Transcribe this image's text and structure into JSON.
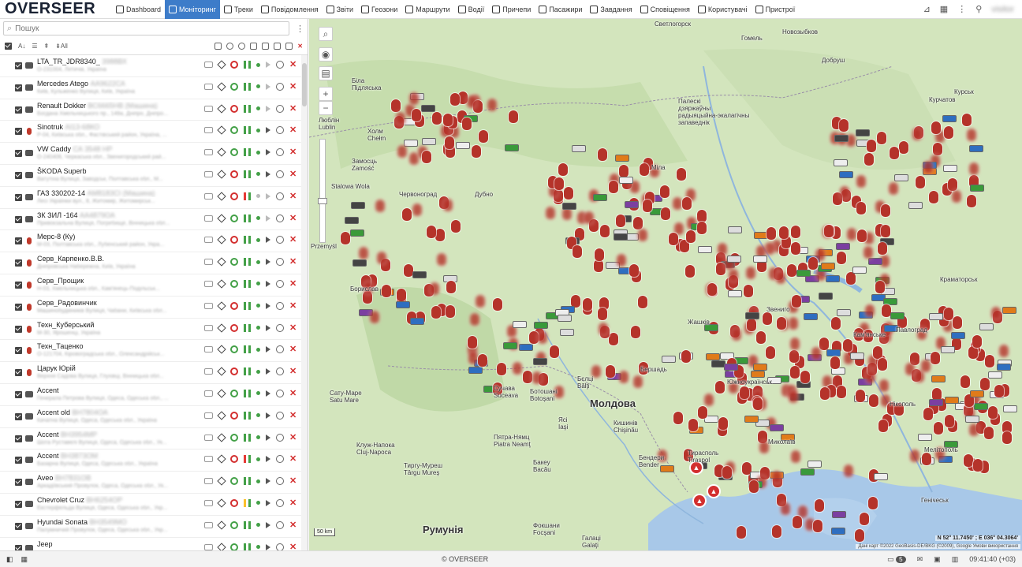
{
  "app": {
    "logo": "OVERSEER"
  },
  "nav": [
    {
      "label": "Dashboard",
      "icon": "chart-icon",
      "active": false
    },
    {
      "label": "Моніторинг",
      "icon": "globe-icon",
      "active": true
    },
    {
      "label": "Треки",
      "icon": "flag-icon",
      "active": false
    },
    {
      "label": "Повідомлення",
      "icon": "list-icon",
      "active": false
    },
    {
      "label": "Звіти",
      "icon": "report-icon",
      "active": false
    },
    {
      "label": "Геозони",
      "icon": "geofence-icon",
      "active": false
    },
    {
      "label": "Маршрути",
      "icon": "route-icon",
      "active": false
    },
    {
      "label": "Водії",
      "icon": "driver-icon",
      "active": false
    },
    {
      "label": "Причепи",
      "icon": "trailer-icon",
      "active": false
    },
    {
      "label": "Пасажири",
      "icon": "passenger-icon",
      "active": false
    },
    {
      "label": "Завдання",
      "icon": "task-icon",
      "active": false
    },
    {
      "label": "Сповіщення",
      "icon": "alarm-icon",
      "active": false
    },
    {
      "label": "Користувачі",
      "icon": "user-icon",
      "active": false
    },
    {
      "label": "Пристрої",
      "icon": "device-icon",
      "active": false
    }
  ],
  "user": {
    "name": "visitor"
  },
  "search": {
    "placeholder": "Пошук"
  },
  "toolbar": {
    "all_label": "All"
  },
  "units": [
    {
      "name": "LTA_TR_JDR8340_",
      "plate": "3988ВХ",
      "addr": "О-231004, Летичів, Україна",
      "icon": "truck",
      "status": "red",
      "pause": "green",
      "dot": "green",
      "play": "grey"
    },
    {
      "name": "Mercedes Atego",
      "plate": "АА9622СА",
      "addr": "Київ, Кульженко Вулиця, Київ, Україна",
      "icon": "van",
      "status": "green",
      "pause": "green",
      "dot": "green",
      "play": "grey"
    },
    {
      "name": "Renault Dokker",
      "plate": "ВС6665НВ (Машина)",
      "addr": "Богдана Хмельницького пр., 148а, Дніпро, Дніпро...",
      "icon": "car",
      "status": "red",
      "pause": "green",
      "dot": "green",
      "play": "grey"
    },
    {
      "name": "Sinotruk",
      "plate": "АІ13-68КО",
      "addr": "Р-04, Київська обл., Фастівський район, Україна, ...",
      "icon": "red",
      "status": "green",
      "pause": "green",
      "dot": "green",
      "play": "gps"
    },
    {
      "name": "VW Caddy",
      "plate": "СА 3548 НР",
      "addr": "О-240406, Черкаська обл., Звенигородський рай...",
      "icon": "car",
      "status": "green",
      "pause": "green",
      "dot": "green",
      "play": "gps"
    },
    {
      "name": "ŠKODA Superb",
      "plate": "",
      "addr": "Ватутіна Вулиця, Заводськ, Полтавська обл., М...",
      "icon": "car",
      "status": "red",
      "pause": "green",
      "dot": "green",
      "play": "gps"
    },
    {
      "name": "ГАЗ 330202-14",
      "plate": "АМ8183СІ (Машина)",
      "addr": "Лесі Українки вул., 8, Житомир, Житомирськ...",
      "icon": "truck",
      "status": "red",
      "pause": "red",
      "dot": "grey",
      "play": "grey"
    },
    {
      "name": "ЗК ЗИЛ -164",
      "plate": "АА4879ОА",
      "addr": "Привокзальна Вулиця, Погребище, Вінницька обл...",
      "icon": "truck",
      "status": "green",
      "pause": "green",
      "dot": "green",
      "play": "grey"
    },
    {
      "name": "Мерс-8 (Ку)",
      "plate": "",
      "addr": "М-03, Полтавська обл., Лубенський район, Укра...",
      "icon": "red",
      "status": "red",
      "pause": "green",
      "dot": "green",
      "play": "gps"
    },
    {
      "name": "Серв_Карпенко.В.В.",
      "plate": "",
      "addr": "Дніпровська Набережна, Київ, Україна",
      "icon": "red",
      "status": "green",
      "pause": "green",
      "dot": "green",
      "play": "gps"
    },
    {
      "name": "Серв_Прощик",
      "plate": "",
      "addr": "Н-03, Хмельницька обл., Кам'янець-Подільськ...",
      "icon": "red",
      "status": "green",
      "pause": "green",
      "dot": "green",
      "play": "gps"
    },
    {
      "name": "Серв_Радовинчик",
      "plate": "",
      "addr": "Машинобудівників Вулиця, Чабани, Київська обл...",
      "icon": "red",
      "status": "red",
      "pause": "green",
      "dot": "green",
      "play": "gps"
    },
    {
      "name": "Техн_Куберський",
      "plate": "",
      "addr": "М-30, Ярошенці, Україна",
      "icon": "red",
      "status": "red",
      "pause": "green",
      "dot": "green",
      "play": "gps"
    },
    {
      "name": "Техн_Таценко",
      "plate": "",
      "addr": "О-121704, Кіровоградська обл., Олександрійськ...",
      "icon": "red",
      "status": "green",
      "pause": "green",
      "dot": "green",
      "play": "gps"
    },
    {
      "name": "Царук Юрій",
      "plate": "",
      "addr": "Верхня Садова Вулиця, Глухівці, Вінницька обл...",
      "icon": "red",
      "status": "red",
      "pause": "green",
      "dot": "green",
      "play": "gps"
    },
    {
      "name": "Accent",
      "plate": "",
      "addr": "Генерала Петрова Вулиця, Одеса, Одеська обл., ...",
      "icon": "car",
      "status": "green",
      "pause": "green",
      "dot": "green",
      "play": "gps"
    },
    {
      "name": "Accent old",
      "plate": "ВН7804ОА",
      "addr": "Качатна Вулиця, Одеса, Одеська обл., Україна",
      "icon": "car",
      "status": "red",
      "pause": "green",
      "dot": "green",
      "play": "gps"
    },
    {
      "name": "Accent",
      "plate": "ВН3954МР",
      "addr": "Шота Руставелі Вулиця, Одеса, Одеська обл., Ук...",
      "icon": "car",
      "status": "green",
      "pause": "green",
      "dot": "green",
      "play": "gps"
    },
    {
      "name": "Accent",
      "plate": "ВН3873ОМ",
      "addr": "Базарна Вулиця, Одеса, Одеська обл., Україна",
      "icon": "car",
      "status": "red",
      "pause": "red",
      "dot": "green",
      "play": "gps"
    },
    {
      "name": "Aveo",
      "plate": "ВН7831ОВ",
      "addr": "Аркадіївський Провулок, Одеса, Одеська обл., Ук...",
      "icon": "car",
      "status": "green",
      "pause": "green",
      "dot": "green",
      "play": "gps"
    },
    {
      "name": "Chevrolet Cruz",
      "plate": "ВН6254ОР",
      "addr": "Екстерфельда Вулиця, Одеса, Одеська обл., Укр...",
      "icon": "car",
      "status": "red",
      "pause": "yellow",
      "dot": "green",
      "play": "gps"
    },
    {
      "name": "Hyundai Sonata",
      "plate": "ВН3549МО",
      "addr": "Палумничий Провулок, Одеса, Одеська обл., Укр...",
      "icon": "car",
      "status": "green",
      "pause": "green",
      "dot": "green",
      "play": "gps"
    },
    {
      "name": "Jeep",
      "plate": "",
      "addr": "",
      "icon": "car",
      "status": "green",
      "pause": "green",
      "dot": "green",
      "play": "gps"
    }
  ],
  "map": {
    "labels": {
      "gomel": "Гомель",
      "svetlogorsk": "Светлогорск",
      "novozybkov": "Новозыбков",
      "lublin": "Люблін\nLublin",
      "kholm": "Холм\nChełm",
      "zamosc": "Замосць\nZamość",
      "stalowa": "Stalowa Wola",
      "chervonograd": "Червоноград",
      "dubno": "Дубно",
      "przemysl": "Przemyśl",
      "moldova": "Молдова",
      "romania": "Румунія",
      "kishinev": "Кишинів\nChişinău",
      "iasi": "Ясі\nIaşi",
      "suceava": "Сучава\nSuceava",
      "botosani": "Ботошані\nBotoşani",
      "balti": "Бєлці\nBălţi",
      "cluj": "Клуж-Напока\nCluj-Napoca",
      "satu_mare": "Сату-Маре\nSatu Mare",
      "targu": "Тиргу-Муреш\nTârgu Mureş",
      "piatra": "Пятра-Нямц\nPiatra Neamţ",
      "bacau": "Бакеу\nBacău",
      "tiraspol": "Тирасполь\nTiraspol",
      "bendery": "Бендери\nBender",
      "kursk": "Курськ",
      "kurchatov": "Курчатов",
      "kramatorsk": "Краматорськ",
      "pavlograd": "Павлоград",
      "kamyanske": "Кам'янське",
      "mykolaiv": "Миколаїв",
      "melitopol": "Мелітополь",
      "genichesk": "Генічеськ",
      "nikopol": "Нікополь",
      "polesie": "Палескі\nдзяржаўны\nрадыяцыйна-экалагічны\nзапаведнік",
      "dalnvi": "Добруш",
      "bila": "Біла\nПідляська",
      "zvenyhorod": "Звениго",
      "balta": "Бершадь",
      "yuzhno": "Южноукраїнськ",
      "zhashkiv": "Жашків",
      "borislav": "Борислав",
      "mila": "Міла",
      "fokshani": "Фокшани\nFocşani",
      "galati": "Галаці\nGalaţi"
    },
    "scale": "50 km",
    "coords": "N 52° 11.7450' ; E 036° 04.3064'",
    "attribution": "Дані карт ©2022 GeoBasis-DE/BKG (©2009), Google   Умови використання"
  },
  "status": {
    "copyright": "© OVERSEER",
    "badge": "5",
    "time": "09:41:40 (+03)"
  },
  "colors": {
    "accent": "#3d7cc9",
    "marker": "#b5332a",
    "land": "#d7e8c2",
    "water": "#a8c8e8"
  }
}
